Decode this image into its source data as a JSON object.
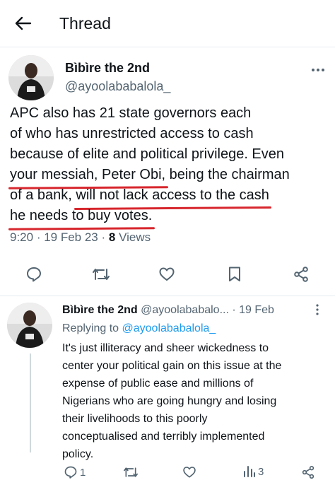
{
  "header": {
    "title": "Thread"
  },
  "main_tweet": {
    "author_name": "Bìbìre the 2nd",
    "author_handle": "@ayoolababalola_",
    "text_lines": [
      [
        "APC also has 21 state governors each",
        "",
        "",
        "",
        ""
      ],
      [
        "of who has unrestricted access to cash",
        "",
        "",
        "",
        ""
      ],
      [
        "because of elite and political privilege. Even",
        "",
        "",
        "",
        ""
      ],
      [
        "",
        "your messiah, Peter Obi,",
        " being the chairman",
        "",
        ""
      ],
      [
        "of a bank, ",
        "will not lack access to the cash",
        "",
        "",
        ""
      ],
      [
        "",
        "he needs to buy votes.",
        "",
        "",
        ""
      ]
    ],
    "time": "9:20",
    "sep1": " · ",
    "date": "19 Feb 23",
    "sep2": " · ",
    "views_count": "8",
    "views_label": " Views"
  },
  "reply_tweet": {
    "author_name": "Bìbìre the 2nd",
    "author_handle": "@ayoolababalo...",
    "date": " · 19 Feb",
    "replying_prefix": "Replying to ",
    "replying_handle": "@ayoolababalola_",
    "text_lines": [
      "It's just illiteracy and sheer wickedness to",
      "center your political gain on this issue at the",
      "expense of public ease and millions of",
      "Nigerians who are going hungry and losing",
      "their livelihoods to this poorly",
      "conceptualised and terribly implemented",
      "policy."
    ],
    "reply_count": "1",
    "views_count": "3"
  },
  "icons": {
    "back": "arrow-left-icon",
    "more": "more-icon",
    "reply": "reply-icon",
    "retweet": "retweet-icon",
    "like": "heart-icon",
    "bookmark": "bookmark-icon",
    "share": "share-icon",
    "views": "views-icon"
  },
  "colors": {
    "text": "#0f1419",
    "secondary": "#536471",
    "link": "#1d9bf0",
    "underline_annotation": "#d7262d"
  }
}
